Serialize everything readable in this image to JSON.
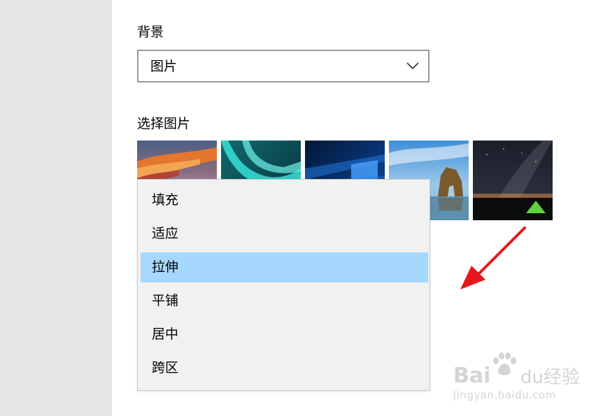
{
  "background": {
    "label": "背景",
    "selected_value": "图片"
  },
  "choose_picture": {
    "label": "选择图片",
    "thumbnails": [
      {
        "name": "sunset-clouds"
      },
      {
        "name": "aurora"
      },
      {
        "name": "windows-light"
      },
      {
        "name": "sea-rock-arch"
      },
      {
        "name": "milky-way-tent"
      }
    ]
  },
  "fit_dropdown": {
    "options": [
      "填充",
      "适应",
      "拉伸",
      "平铺",
      "居中",
      "跨区"
    ],
    "selected": "拉伸"
  },
  "annotation": {
    "arrow_color": "#e8161d"
  },
  "colors": {
    "left_nav": "#e6e6e6",
    "dropdown_bg": "#f1f1f1",
    "selected_option": "#a6d8fd",
    "combo_border": "#999999",
    "watermark": "#d4d4d4"
  },
  "watermark": {
    "brand": "Bai",
    "brand_suffix": "du",
    "cn": "经验",
    "url": "jingyan.baidu.com"
  }
}
